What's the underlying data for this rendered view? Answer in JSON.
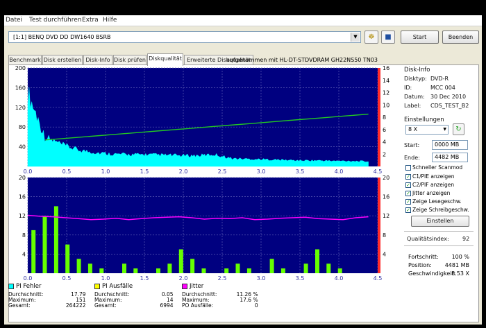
{
  "menu": [
    "Datei",
    "Test durchführen",
    "Extra",
    "Hilfe"
  ],
  "toolbar": {
    "drive": "[1:1]   BENQ DVD DD DW1640 BSRB",
    "start_label": "Start",
    "exit_label": "Beenden"
  },
  "tabs": [
    "Benchmark",
    "Disk erstellen",
    "Disk-Info",
    "Disk prüfen",
    "Diskqualität",
    "Erweiterte Diskqualität"
  ],
  "active_tab": "Diskqualität",
  "chart_header": "aufgenommen mit HL-DT-STDVDRAM GH22NS50    TN03",
  "colors": {
    "plot_bg": "#000080",
    "grid": "#5a5ab4",
    "pie": "#00ffff",
    "pif": "#66ff00",
    "jitter": "#ff00ff",
    "speed": "#22c722",
    "axis_red": "#ff2b2b"
  },
  "chart_data": [
    {
      "type": "area",
      "series": [
        {
          "name": "PI Fehler",
          "values": [
            150,
            60,
            44,
            33,
            28,
            25,
            24,
            24,
            23,
            22,
            22,
            24,
            16,
            15,
            14,
            13,
            12,
            12,
            11,
            11,
            10
          ]
        },
        {
          "name": "",
          "values": [
            4.3,
            4.6,
            4.9,
            5.2,
            5.5,
            5.8,
            6.1,
            6.4,
            6.7,
            7.0,
            7.3,
            7.6,
            7.9,
            8.2,
            8.5
          ]
        }
      ],
      "xlim": [
        0,
        4.5
      ],
      "ylim": [
        0,
        200
      ],
      "y2lim": [
        0,
        16
      ],
      "xticks": [
        "0.0",
        "0.5",
        "1.0",
        "1.5",
        "2.0",
        "2.5",
        "3.0",
        "3.5",
        "4.0",
        "4.5"
      ],
      "yticks": [
        "200",
        "160",
        "120",
        "80",
        "40"
      ],
      "y2ticks": [
        "16",
        "14",
        "12",
        "10",
        "8",
        "6",
        "4",
        "2"
      ]
    },
    {
      "type": "bar",
      "series": [
        {
          "name": "PI Ausfälle",
          "values": [
            9,
            12,
            14,
            6,
            3,
            2,
            1,
            0,
            2,
            1,
            0,
            1,
            2,
            5,
            3,
            1,
            0,
            1,
            2,
            1,
            0,
            3,
            1,
            0,
            2,
            5,
            2,
            1,
            0,
            0
          ]
        },
        {
          "name": "Jitter",
          "values": [
            12.1,
            11.9,
            11.8,
            11.6,
            11.4,
            11.2,
            11.3,
            11.5,
            11.2,
            11.4,
            11.6,
            11.7,
            11.8,
            11.6,
            11.3,
            11.5,
            11.4,
            11.6,
            11.2,
            11.3,
            11.5,
            11.6,
            11.7,
            11.4,
            11.3,
            11.2,
            11.6,
            11.8
          ]
        }
      ],
      "xlim": [
        0,
        4.5
      ],
      "ylim": [
        0,
        20
      ],
      "xticks": [
        "0.0",
        "0.5",
        "1.0",
        "1.5",
        "2.0",
        "2.5",
        "3.0",
        "3.5",
        "4.0",
        "4.5"
      ],
      "yticks": [
        "20",
        "16",
        "12",
        "8",
        "4"
      ],
      "y2ticks": [
        "20",
        "16",
        "12",
        "8",
        "4"
      ]
    }
  ],
  "stats": {
    "pie": {
      "title": "PI Fehler",
      "avg_label": "Durchschnitt:",
      "avg": "17.79",
      "max_label": "Maximum:",
      "max": "151",
      "total_label": "Gesamt:",
      "total": "264222"
    },
    "pif": {
      "title": "PI Ausfälle",
      "avg_label": "Durchschnitt:",
      "avg": "0.05",
      "max_label": "Maximum:",
      "max": "14",
      "total_label": "Gesamt:",
      "total": "6994"
    },
    "jitter": {
      "title": "Jitter",
      "avg_label": "Durchschnitt:",
      "avg": "11.26 %",
      "max_label": "Maximum:",
      "max": "17.6 %",
      "po_label": "PO Ausfälle:",
      "po": "0"
    }
  },
  "disk_info": {
    "title": "Disk-Info",
    "type_label": "Disktyp:",
    "type": "DVD-R",
    "id_label": "ID:",
    "id": "MCC 004",
    "date_label": "Datum:",
    "date": "30 Dec 2010",
    "label_label": "Label:",
    "label": "CDS_TEST_B2"
  },
  "settings": {
    "title": "Einstellungen",
    "speed": "8 X",
    "start_label": "Start:",
    "start": "0000 MB",
    "end_label": "Ende:",
    "end": "4482 MB",
    "quick_scan": "Schneller Scanmod",
    "checks": [
      "C1/PIE anzeigen",
      "C2/PIF anzeigen",
      "Jitter anzeigen",
      "Zeige Lesegeschw.",
      "Zeige Schreibgeschw."
    ],
    "apply_label": "Einstellen"
  },
  "quality_label": "Qualitätsindex:",
  "quality": "92",
  "results": {
    "progress_label": "Fortschritt:",
    "progress": "100 %",
    "position_label": "Position:",
    "position": "4481 MB",
    "speed_label": "Geschwindigkeit:",
    "speed": "8.53 X"
  }
}
